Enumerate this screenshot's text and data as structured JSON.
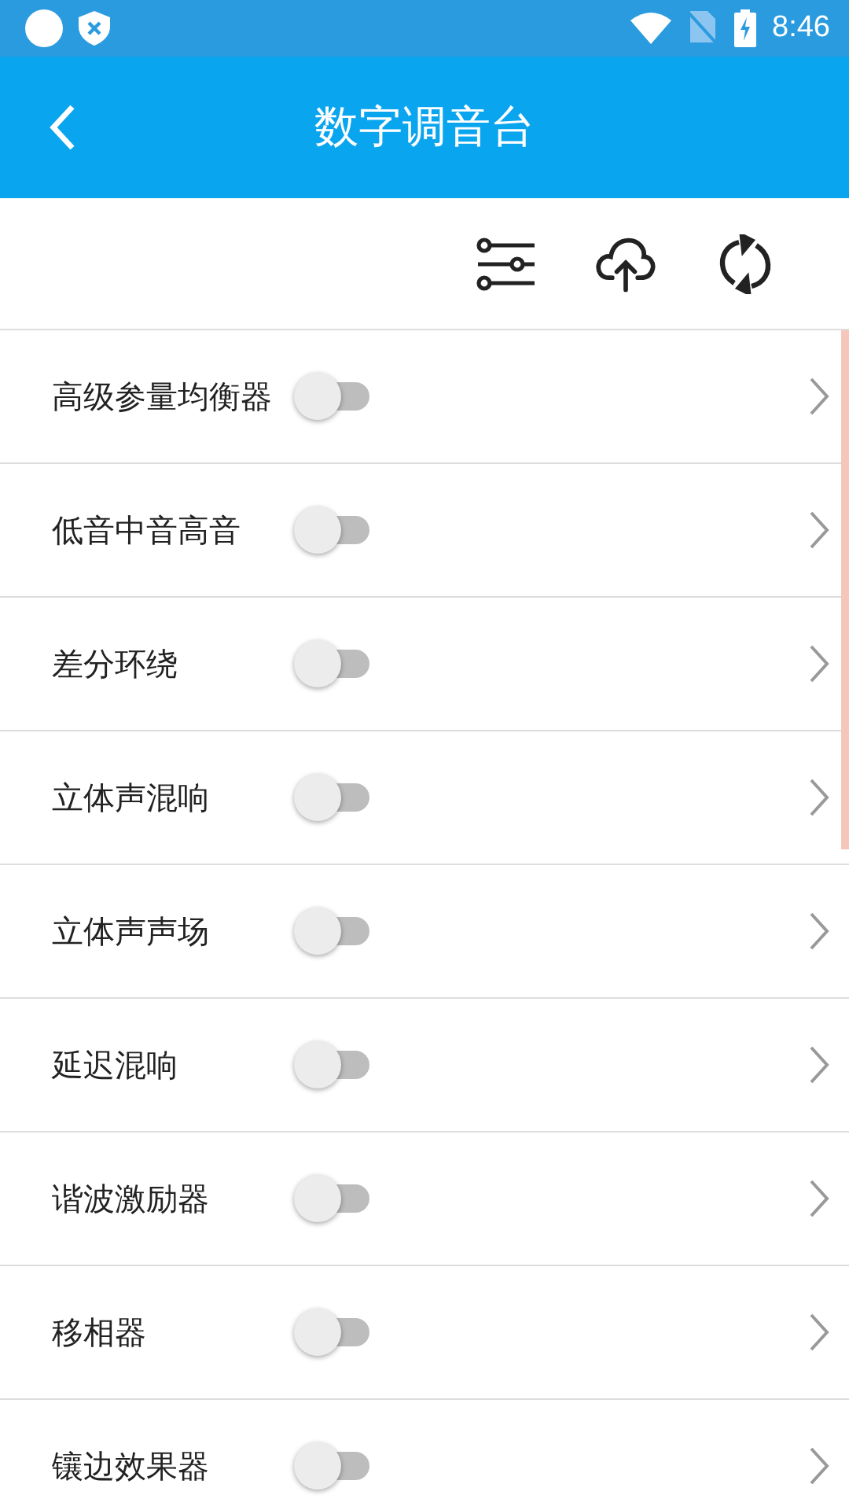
{
  "status_bar": {
    "time": "8:46"
  },
  "header": {
    "title": "数字调音台"
  },
  "effects": [
    {
      "name": "高级参量均衡器",
      "on": false
    },
    {
      "name": "低音中音高音",
      "on": false
    },
    {
      "name": "差分环绕",
      "on": false
    },
    {
      "name": "立体声混响",
      "on": false
    },
    {
      "name": "立体声声场",
      "on": false
    },
    {
      "name": "延迟混响",
      "on": false
    },
    {
      "name": "谐波激励器",
      "on": false
    },
    {
      "name": "移相器",
      "on": false
    },
    {
      "name": "镶边效果器",
      "on": false
    }
  ]
}
